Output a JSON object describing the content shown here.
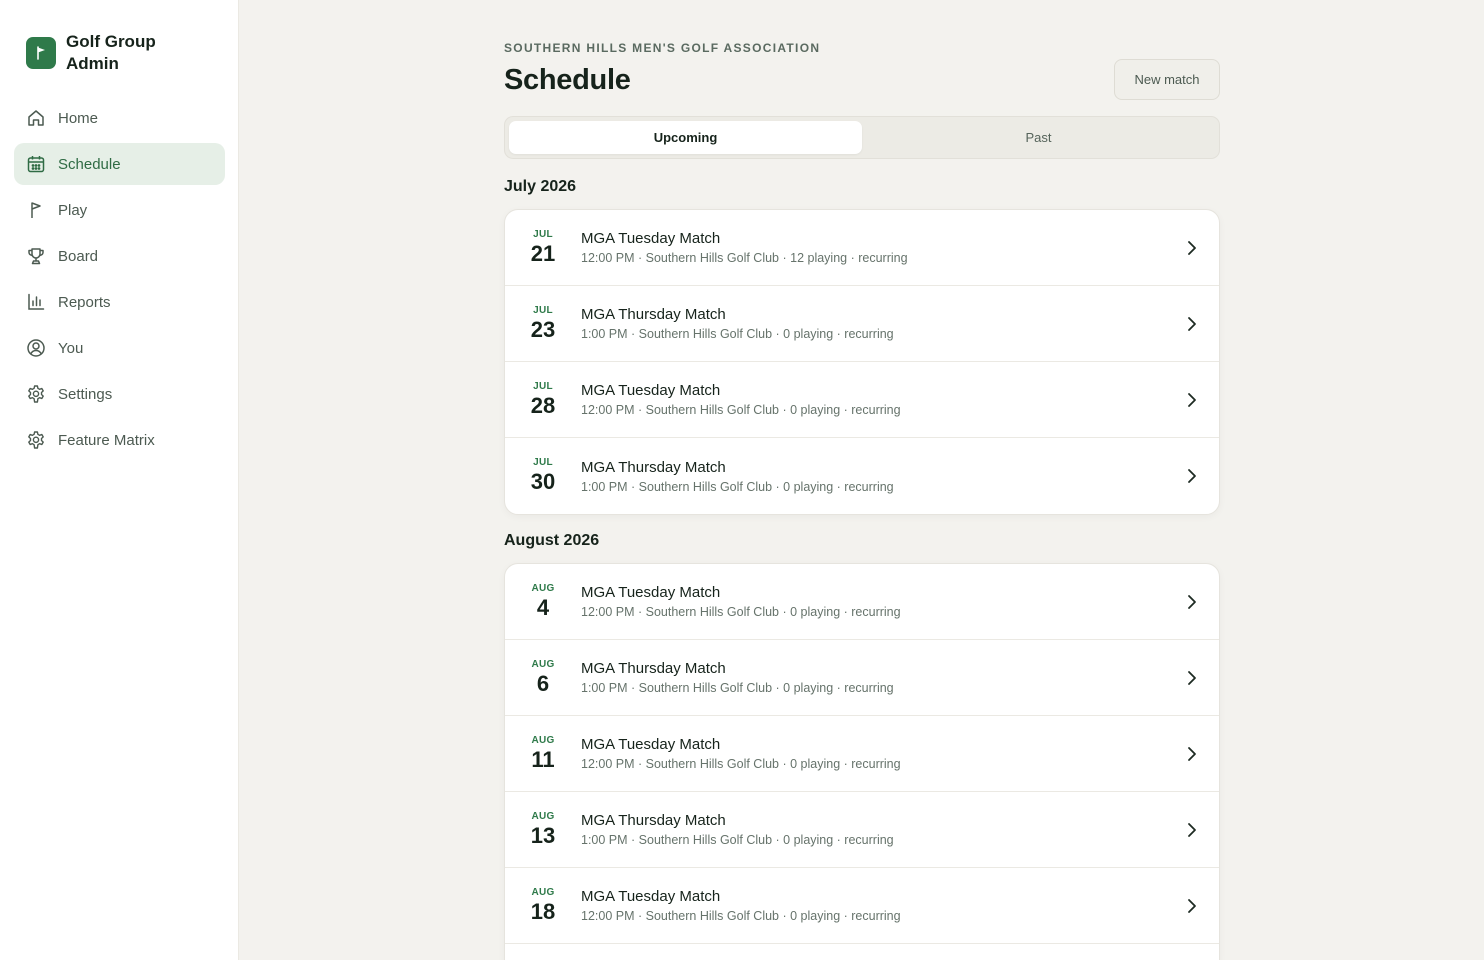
{
  "app": {
    "name": "Golf Group Admin",
    "brand_color": "#2f7a4a"
  },
  "sidebar": {
    "items": [
      {
        "label": "Home",
        "icon": "home-icon",
        "active": false
      },
      {
        "label": "Schedule",
        "icon": "calendar-icon",
        "active": true
      },
      {
        "label": "Play",
        "icon": "flag-icon",
        "active": false
      },
      {
        "label": "Board",
        "icon": "trophy-icon",
        "active": false
      },
      {
        "label": "Reports",
        "icon": "bar-chart-icon",
        "active": false
      },
      {
        "label": "You",
        "icon": "user-circle-icon",
        "active": false
      },
      {
        "label": "Settings",
        "icon": "gear-icon",
        "active": false
      },
      {
        "label": "Feature Matrix",
        "icon": "gear-icon",
        "active": false
      }
    ]
  },
  "header": {
    "org": "SOUTHERN HILLS MEN'S GOLF ASSOCIATION",
    "title": "Schedule",
    "new_match_label": "New match"
  },
  "tabs": [
    {
      "label": "Upcoming",
      "active": true
    },
    {
      "label": "Past",
      "active": false
    }
  ],
  "months": [
    {
      "label": "July 2026",
      "events": [
        {
          "mon": "JUL",
          "day": "21",
          "title": "MGA Tuesday Match",
          "sub": "12:00 PM · Southern Hills Golf Club · 12 playing · recurring"
        },
        {
          "mon": "JUL",
          "day": "23",
          "title": "MGA Thursday Match",
          "sub": "1:00 PM · Southern Hills Golf Club · 0 playing · recurring"
        },
        {
          "mon": "JUL",
          "day": "28",
          "title": "MGA Tuesday Match",
          "sub": "12:00 PM · Southern Hills Golf Club · 0 playing · recurring"
        },
        {
          "mon": "JUL",
          "day": "30",
          "title": "MGA Thursday Match",
          "sub": "1:00 PM · Southern Hills Golf Club · 0 playing · recurring"
        }
      ]
    },
    {
      "label": "August 2026",
      "events": [
        {
          "mon": "AUG",
          "day": "4",
          "title": "MGA Tuesday Match",
          "sub": "12:00 PM · Southern Hills Golf Club · 0 playing · recurring"
        },
        {
          "mon": "AUG",
          "day": "6",
          "title": "MGA Thursday Match",
          "sub": "1:00 PM · Southern Hills Golf Club · 0 playing · recurring"
        },
        {
          "mon": "AUG",
          "day": "11",
          "title": "MGA Tuesday Match",
          "sub": "12:00 PM · Southern Hills Golf Club · 0 playing · recurring"
        },
        {
          "mon": "AUG",
          "day": "13",
          "title": "MGA Thursday Match",
          "sub": "1:00 PM · Southern Hills Golf Club · 0 playing · recurring"
        },
        {
          "mon": "AUG",
          "day": "18",
          "title": "MGA Tuesday Match",
          "sub": "12:00 PM · Southern Hills Golf Club · 0 playing · recurring"
        }
      ]
    }
  ]
}
